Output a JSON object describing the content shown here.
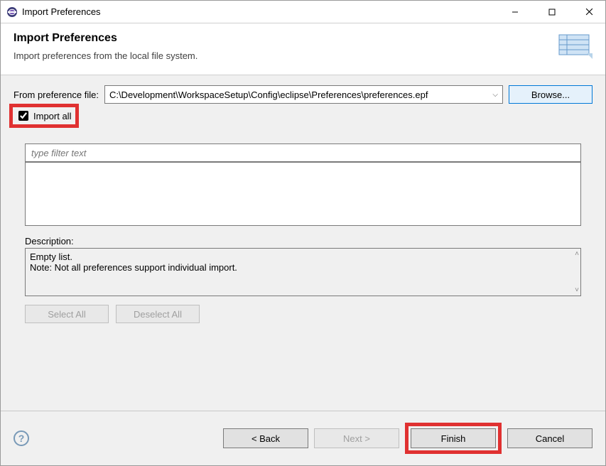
{
  "windowTitle": "Import Preferences",
  "header": {
    "title": "Import Preferences",
    "subtitle": "Import preferences from the local file system."
  },
  "fileRow": {
    "label": "From preference file:",
    "value": "C:\\Development\\WorkspaceSetup\\Config\\eclipse\\Preferences\\preferences.epf",
    "browseLabel": "Browse..."
  },
  "importAll": {
    "label": "Import all",
    "checked": true
  },
  "filter": {
    "placeholder": "type filter text"
  },
  "description": {
    "label": "Description:",
    "line1": "Empty list.",
    "line2": "Note: Not all preferences support individual import."
  },
  "buttons": {
    "selectAll": "Select All",
    "deselectAll": "Deselect All",
    "back": "< Back",
    "next": "Next >",
    "finish": "Finish",
    "cancel": "Cancel"
  }
}
